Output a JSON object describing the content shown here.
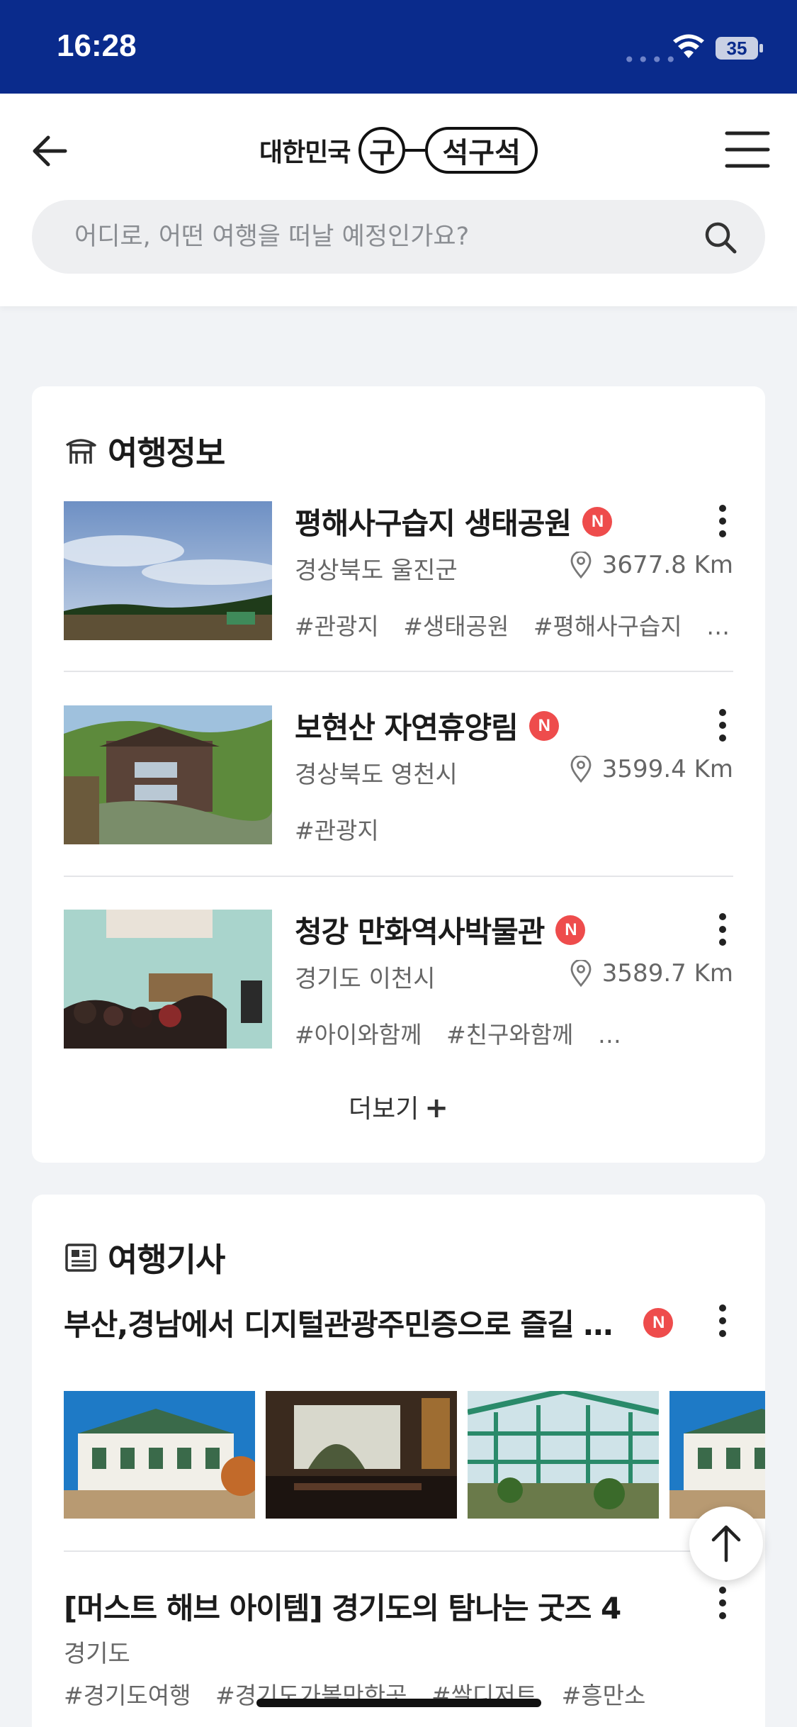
{
  "status_bar": {
    "time": "16:28",
    "signal": "••••",
    "battery": "35"
  },
  "header": {
    "logo": {
      "prefix": "대한민국",
      "circle_char": "구",
      "pill_text": "석구석"
    },
    "search": {
      "placeholder": "어디로, 어떤 여행을 떠날 예정인가요?"
    }
  },
  "travel_info": {
    "title": "여행정보",
    "items": [
      {
        "name": "평해사구습지 생태공원",
        "badge": "N",
        "region": "경상북도 울진군",
        "distance": "3677.8 Km",
        "tags": [
          "#관광지",
          "#생태공원",
          "#평해사구습지",
          "…"
        ]
      },
      {
        "name": "보현산 자연휴양림",
        "badge": "N",
        "region": "경상북도 영천시",
        "distance": "3599.4 Km",
        "tags": [
          "#관광지"
        ]
      },
      {
        "name": "청강 만화역사박물관",
        "badge": "N",
        "region": "경기도 이천시",
        "distance": "3589.7 Km",
        "tags": [
          "#아이와함께",
          "#친구와함께",
          "…"
        ]
      }
    ],
    "more_label": "더보기",
    "more_symbol": "+"
  },
  "travel_articles": {
    "title": "여행기사",
    "article1": {
      "title": "부산,경남에서 디지털관광주민증으로 즐길 수…",
      "badge": "N"
    },
    "article2": {
      "title": "[머스트 해브 아이템] 경기도의 탐나는 굿즈 4",
      "region": "경기도",
      "tags": [
        "#경기도여행",
        "#경기도가볼만한곳",
        "#쌀디저트",
        "#흥만소"
      ]
    }
  },
  "colors": {
    "status_bar": "#0a2b8c",
    "badge": "#ee4c4c",
    "background": "#f1f3f6"
  }
}
